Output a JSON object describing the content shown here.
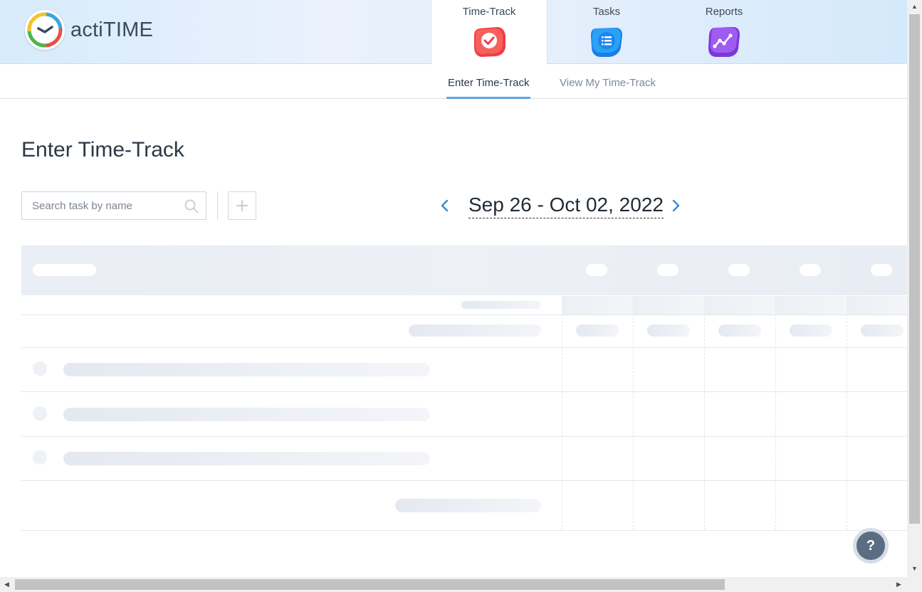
{
  "app": {
    "name": "actiTIME"
  },
  "nav": {
    "tabs": [
      {
        "label": "Time-Track",
        "icon": "checkmark-icon",
        "color": "#f0434c",
        "active": true
      },
      {
        "label": "Tasks",
        "icon": "list-icon",
        "color": "#1f8ef0",
        "active": false
      },
      {
        "label": "Reports",
        "icon": "chart-icon",
        "color": "#8c48e0",
        "active": false
      }
    ]
  },
  "subnav": {
    "tabs": [
      {
        "label": "Enter Time-Track",
        "active": true
      },
      {
        "label": "View My Time-Track",
        "active": false
      }
    ]
  },
  "page": {
    "title": "Enter Time-Track"
  },
  "toolbar": {
    "search_placeholder": "Search task by name",
    "add_icon": "plus-icon",
    "date_range": "Sep 26 - Oct 02, 2022"
  },
  "help": {
    "label": "?"
  },
  "colors": {
    "accent": "#5fa4e8",
    "date_arrow": "#3b8bd0",
    "help_bg": "#5b6d82"
  }
}
